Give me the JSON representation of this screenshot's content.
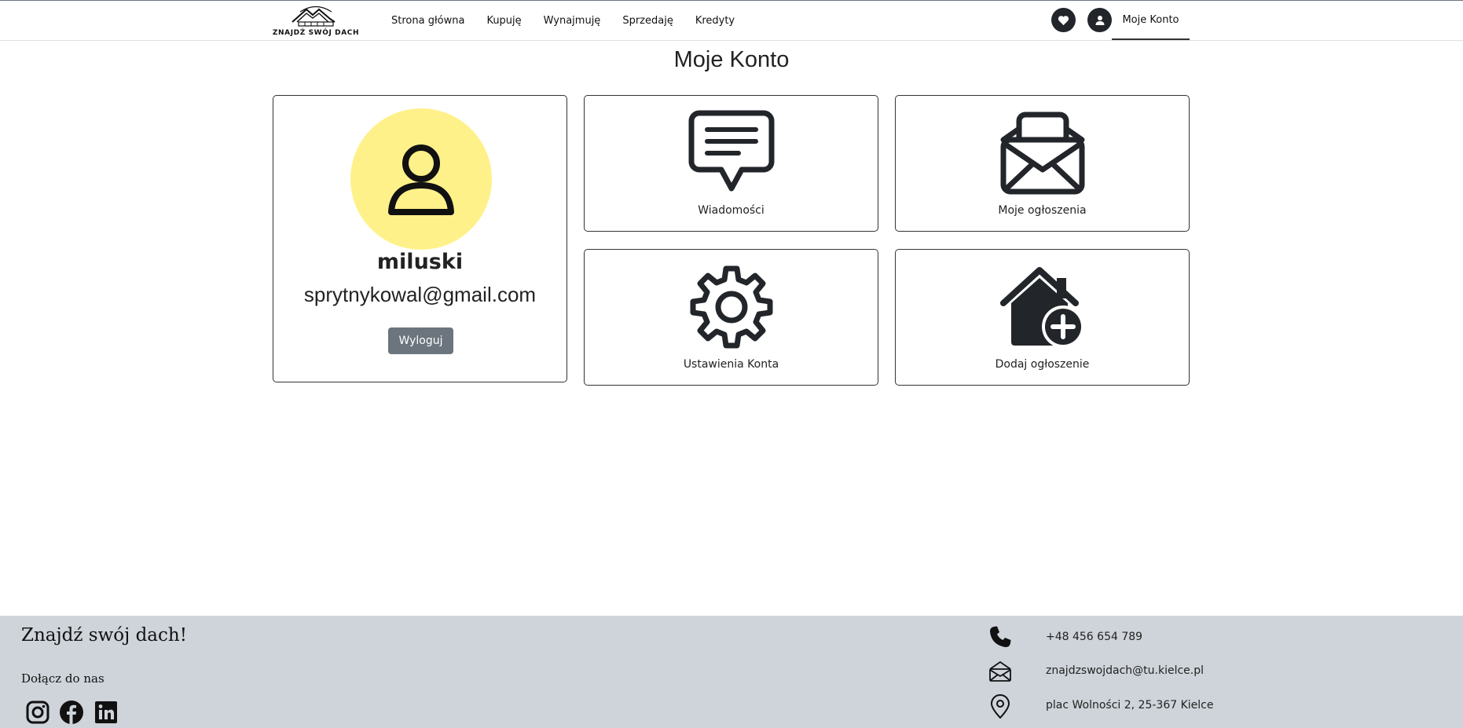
{
  "header": {
    "logo_text": "ZNAJDŹ SWÓJ DACH",
    "nav": [
      "Strona główna",
      "Kupuję",
      "Wynajmuję",
      "Sprzedaję",
      "Kredyty"
    ],
    "account_label": "Moje Konto",
    "icons": [
      "heart-icon",
      "user-icon"
    ]
  },
  "main": {
    "title": "Moje Konto",
    "profile": {
      "username": "miluski",
      "email": "sprytnykowal@gmail.com",
      "logout_label": "Wyloguj",
      "avatar_bg": "#fff18a"
    },
    "tiles": [
      {
        "label": "Wiadomości",
        "icon": "message-icon"
      },
      {
        "label": "Moje ogłoszenia",
        "icon": "open-envelope-icon"
      },
      {
        "label": "Ustawienia Konta",
        "icon": "gear-icon"
      },
      {
        "label": "Dodaj ogłoszenie",
        "icon": "house-add-icon"
      }
    ]
  },
  "footer": {
    "title": "Znajdź swój dach!",
    "join_label": "Dołącz do nas",
    "social": [
      "instagram-icon",
      "facebook-icon",
      "linkedin-icon"
    ],
    "contacts": [
      {
        "icon": "phone-icon",
        "text": "+48 456 654 789"
      },
      {
        "icon": "envelope-icon",
        "text": "znajdzswojdach@tu.kielce.pl"
      },
      {
        "icon": "location-icon",
        "text": "plac Wolności 2, 25-367 Kielce"
      }
    ],
    "background": "#ced4da"
  },
  "colors": {
    "dark": "#222529",
    "button_gray": "#6c757d"
  }
}
